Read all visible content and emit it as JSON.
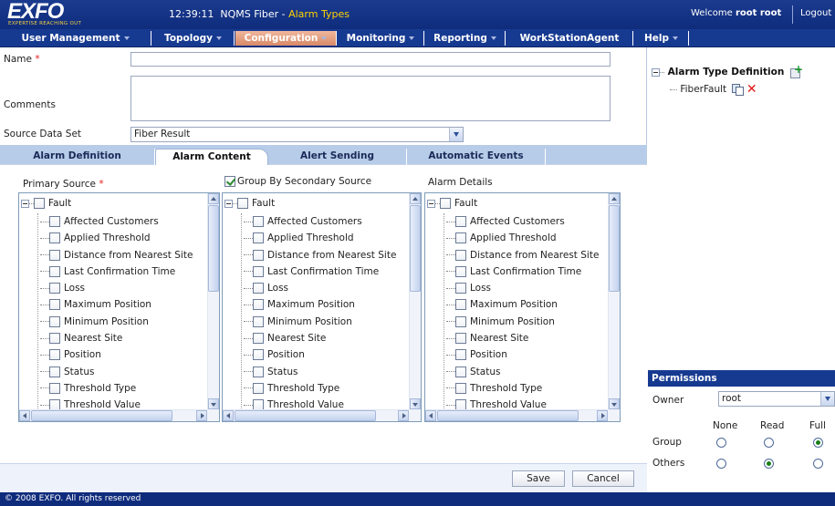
{
  "header": {
    "logo_text": "EXFO",
    "logo_tagline": "EXPERTISE REACHING OUT",
    "time": "12:39:11",
    "app_name": "NQMS Fiber",
    "separator": " - ",
    "page_name": "Alarm Types",
    "welcome_prefix": "Welcome",
    "user": "root root",
    "logout": "Logout"
  },
  "nav": {
    "items": [
      {
        "label": "User Management"
      },
      {
        "label": "Topology"
      },
      {
        "label": "Configuration"
      },
      {
        "label": "Monitoring"
      },
      {
        "label": "Reporting"
      },
      {
        "label": "WorkStationAgent"
      },
      {
        "label": "Help"
      }
    ],
    "active": "Configuration"
  },
  "form": {
    "name_label": "Name",
    "required_mark": "*",
    "name_value": "",
    "comments_label": "Comments",
    "comments_value": "",
    "source_label": "Source Data Set",
    "source_value": "Fiber Result"
  },
  "tabs": [
    {
      "label": "Alarm Definition"
    },
    {
      "label": "Alarm Content"
    },
    {
      "label": "Alert Sending"
    },
    {
      "label": "Automatic Events"
    }
  ],
  "active_tab": "Alarm Content",
  "panels": {
    "primary_label": "Primary Source",
    "group_label": "Group By Secondary Source",
    "group_checked": true,
    "details_label": "Alarm Details",
    "root": "Fault",
    "items_primary": [
      "Affected Customers",
      "Applied Threshold",
      "Distance from Nearest Site",
      "Last Confirmation Time",
      "Loss",
      "Maximum Position",
      "Minimum Position",
      "Nearest Site",
      "Position",
      "Status",
      "Threshold Type",
      "Threshold Value"
    ],
    "items_secondary": [
      "Affected Customers",
      "Applied Threshold",
      "Distance from Nearest Site",
      "Last Confirmation Time",
      "Loss",
      "Maximum Position",
      "Minimum Position",
      "Nearest Site",
      "Position",
      "Status",
      "Threshold Type",
      "Threshold Value"
    ],
    "items_details": [
      "Affected Customers",
      "Applied Threshold",
      "Distance from Nearest Site",
      "Last Confirmation Time",
      "Loss",
      "Maximum Position",
      "Minimum Position",
      "Nearest Site",
      "Position",
      "Status",
      "Threshold Type",
      "Threshold Value"
    ]
  },
  "buttons": {
    "save": "Save",
    "cancel": "Cancel"
  },
  "right_tree": {
    "root": "Alarm Type Definition",
    "child": "FiberFault"
  },
  "permissions": {
    "title": "Permissions",
    "owner_label": "Owner",
    "owner_value": "root",
    "columns": [
      "None",
      "Read",
      "Full"
    ],
    "rows": [
      {
        "label": "Group",
        "selected": "Full"
      },
      {
        "label": "Others",
        "selected": "Read"
      }
    ]
  },
  "footer": {
    "copyright": "© 2008 EXFO. All rights reserved"
  },
  "colors": {
    "header_bg": "#0f2c7c",
    "active_nav": "#d88a68",
    "highlight_text": "#ffd200",
    "required": "#e02020"
  }
}
